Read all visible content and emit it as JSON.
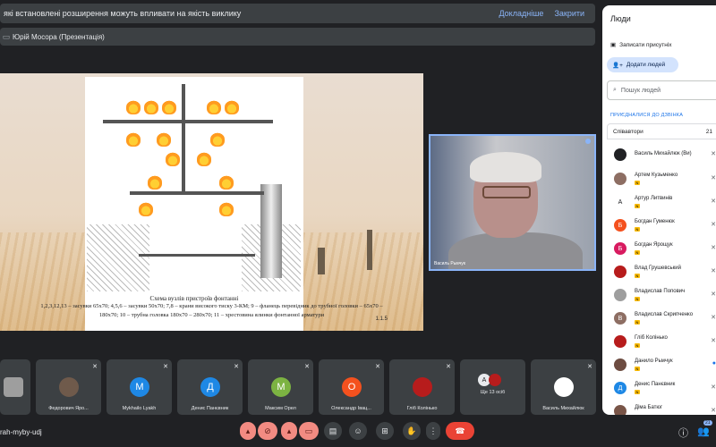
{
  "banner": {
    "message": "які встановлені розширення можуть впливати на якість виклику",
    "learn_more": "Докладніше",
    "close": "Закрити"
  },
  "presenter": {
    "label": "Юрій Мосора (Презентація)"
  },
  "slide": {
    "caption_line1": "Схема вузлів пристроїв фонтанні",
    "caption_line2": "1,2,3,12,13 – засувки 65х70; 4,5,6 – засувки 50х70; 7,8 – крани високого тиску 3-КМ; 9 – фланець перевідник до трубної головки – 65х70 –",
    "caption_line3": "180х70; 10 – трубна головка 180х70 – 280х70; 11 – хрестовина ялинки фонтанної арматури",
    "page_num": "1.1.5",
    "part_labels": [
      "1",
      "2",
      "3",
      "4",
      "5",
      "6",
      "7",
      "8",
      "9",
      "10",
      "11",
      "12",
      "13"
    ]
  },
  "self_view": {
    "name": "Василь Рьмчук"
  },
  "tiles": [
    {
      "name": "",
      "initial": "",
      "color": "#9e9e9e",
      "photo": true
    },
    {
      "name": "Федорович Яро...",
      "initial": "",
      "color": "#6f5a4b",
      "photo": true
    },
    {
      "name": "Mykhailo Lyakh",
      "initial": "M",
      "color": "#1e88e5"
    },
    {
      "name": "Денис Панєвник",
      "initial": "Д",
      "color": "#1e88e5"
    },
    {
      "name": "Максим Орел",
      "initial": "М",
      "color": "#7cb342"
    },
    {
      "name": "Олександр Івац...",
      "initial": "О",
      "color": "#f4511e"
    },
    {
      "name": "Гліб Колінько",
      "initial": "",
      "color": "#b71c1c",
      "photo": true
    },
    {
      "name": "Ще 13 осіб",
      "initial": "A",
      "color": "#5f6368"
    },
    {
      "name": "Василь Михайлюк",
      "initial": "",
      "color": "#202124",
      "photo": true
    }
  ],
  "bottom": {
    "meeting_code": "rah-myby-udj",
    "people_count": "21"
  },
  "panel": {
    "title": "Люди",
    "record_attendance": "Записати присутніх",
    "add_people": "Додати людей",
    "search_placeholder": "Пошук людей",
    "section": "ПРИЄДНАЛИСЯ ДО ДЗВІНКА",
    "group_label": "Співавтори",
    "group_count": "21",
    "people": [
      {
        "name": "Василь Михайлюк (Ви)",
        "initial": "",
        "color": "#202124",
        "tag": false
      },
      {
        "name": "Артем Кузьменко",
        "initial": "",
        "color": "#8d6e63",
        "tag": true
      },
      {
        "name": "Артур Литвинів",
        "initial": "A",
        "color": "#ffffff",
        "tag": true
      },
      {
        "name": "Богдан Гуменюк",
        "initial": "Б",
        "color": "#f4511e",
        "tag": true
      },
      {
        "name": "Богдан Ярощук",
        "initial": "Б",
        "color": "#d81b60",
        "tag": true
      },
      {
        "name": "Влад Грушевський",
        "initial": "",
        "color": "#b71c1c",
        "tag": true
      },
      {
        "name": "Владислав Попович",
        "initial": "",
        "color": "#9e9e9e",
        "tag": true
      },
      {
        "name": "Владислав Скрипченко",
        "initial": "В",
        "color": "#8d6e63",
        "tag": true
      },
      {
        "name": "Гліб Колінько",
        "initial": "",
        "color": "#b71c1c",
        "tag": true
      },
      {
        "name": "Данило Рьмчук",
        "initial": "",
        "color": "#6d4c41",
        "tag": true
      },
      {
        "name": "Денис Панєвник",
        "initial": "Д",
        "color": "#1e88e5",
        "tag": true
      },
      {
        "name": "Діма Батюг",
        "initial": "",
        "color": "#795548",
        "tag": true
      }
    ]
  }
}
